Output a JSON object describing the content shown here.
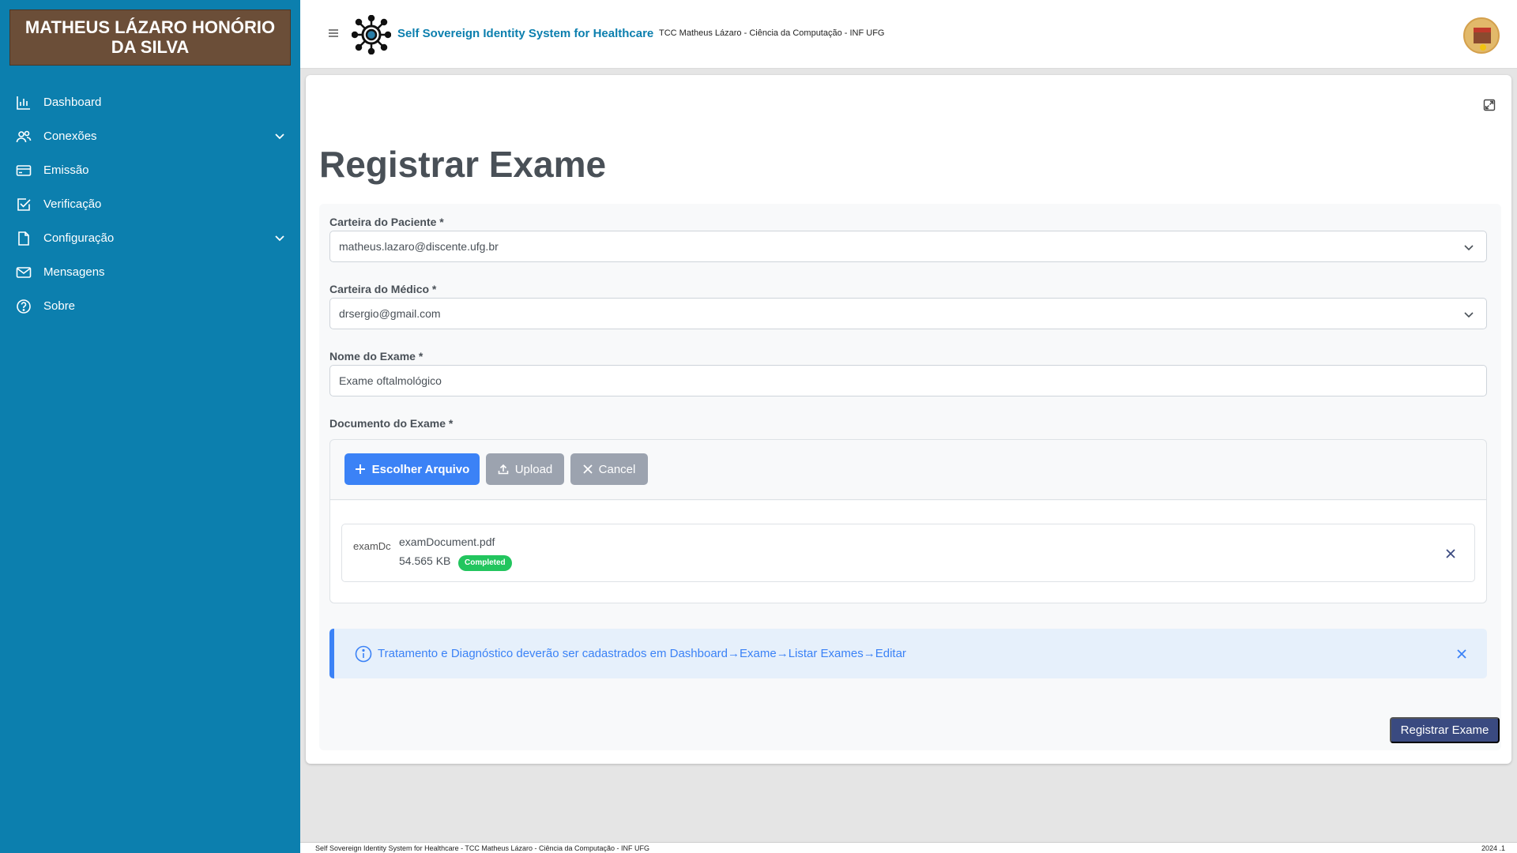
{
  "user": {
    "name": "MATHEUS LÁZARO HONÓRIO DA SILVA"
  },
  "sidebar": {
    "items": [
      {
        "label": "Dashboard",
        "icon": "chart-bar-icon"
      },
      {
        "label": "Conexões",
        "icon": "users-icon",
        "expandable": true
      },
      {
        "label": "Emissão",
        "icon": "credit-card-icon"
      },
      {
        "label": "Verificação",
        "icon": "check-square-icon"
      },
      {
        "label": "Configuração",
        "icon": "file-icon",
        "expandable": true
      },
      {
        "label": "Mensagens",
        "icon": "mail-icon"
      },
      {
        "label": "Sobre",
        "icon": "question-circle-icon"
      }
    ]
  },
  "header": {
    "title": "Self Sovereign Identity System for Healthcare",
    "subtitle": "TCC Matheus Lázaro - Ciência da Computação - INF UFG"
  },
  "page": {
    "title": "Registrar Exame"
  },
  "form": {
    "patient_label": "Carteira do Paciente *",
    "patient_value": "matheus.lazaro@discente.ufg.br",
    "doctor_label": "Carteira do Médico *",
    "doctor_value": "drsergio@gmail.com",
    "exam_name_label": "Nome do Exame *",
    "exam_name_value": "Exame oftalmológico",
    "document_label": "Documento do Exame *",
    "choose_label": "Escolher Arquivo",
    "upload_label": "Upload",
    "cancel_label": "Cancel",
    "file": {
      "thumb_alt": "examDc",
      "name": "examDocument.pdf",
      "size": "54.565 KB",
      "status": "Completed"
    },
    "alert_text": "Tratamento e Diagnóstico deverão ser cadastrados em Dashboard→Exame→Listar Exames→Editar",
    "submit_label": "Registrar Exame"
  },
  "footer": {
    "left": "Self Sovereign Identity System for Healthcare - TCC Matheus Lázaro - Ciência da Computação - INF UFG",
    "right": "2024 .1"
  },
  "colors": {
    "sidebar": "#0c7fae",
    "primary": "#3b82f6",
    "submit": "#3a4a80",
    "success": "#22c55e"
  }
}
